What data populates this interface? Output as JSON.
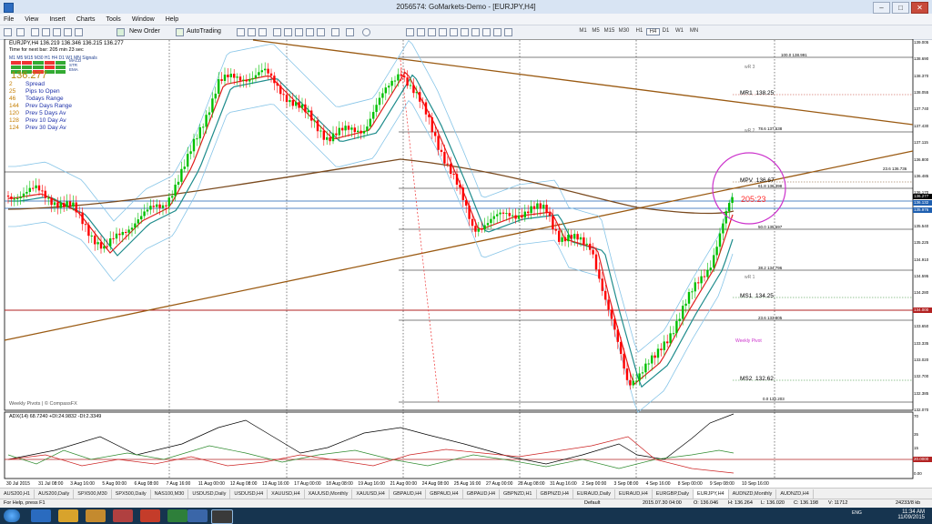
{
  "window": {
    "title": "2056574: GoMarkets-Demo - [EURJPY,H4]",
    "controls": [
      "–",
      "□",
      "✕"
    ]
  },
  "menu": [
    "File",
    "View",
    "Insert",
    "Charts",
    "Tools",
    "Window",
    "Help"
  ],
  "toolbar": {
    "new_order": "New Order",
    "autotrading": "AutoTrading",
    "timeframes": [
      "M1",
      "M5",
      "M15",
      "M30",
      "H1",
      "H4",
      "D1",
      "W1",
      "MN"
    ],
    "active_timeframe": "H4"
  },
  "chart": {
    "header": "EURJPY,H4  136.219 136.346 136.215 136.277",
    "time_next_bar": "Time for next bar: 205 min 23 sec",
    "signal_header": "M1 M5 M15 M30 H1 H4 D1 W1 MN   Signals",
    "indicator_names": [
      "MACD",
      "STR",
      "EMA"
    ],
    "price": "136.277",
    "stats": [
      {
        "value": "2",
        "label": "Spread"
      },
      {
        "value": "25",
        "label": "Pips to Open"
      },
      {
        "value": "46",
        "label": "Todays Range"
      },
      {
        "value": "144",
        "label": "Prev Days Range"
      },
      {
        "value": "120",
        "label": "Prev 5 Days Av"
      },
      {
        "value": "128",
        "label": "Prev 10 Day Av"
      },
      {
        "value": "124",
        "label": "Prev 30 Day Av"
      }
    ],
    "y_axis": [
      "139.005",
      "138.690",
      "138.370",
      "138.055",
      "137.740",
      "137.430",
      "137.115",
      "136.800",
      "136.485",
      "136.170",
      "135.855",
      "135.540",
      "135.225",
      "134.910",
      "134.595",
      "134.280",
      "133.965",
      "133.650",
      "133.335",
      "133.020",
      "132.700",
      "132.385",
      "132.070"
    ],
    "price_tags": [
      {
        "text": "136.277",
        "color": "#000000"
      },
      {
        "text": "136.132",
        "color": "#1e5fb0"
      },
      {
        "text": "135.976",
        "color": "#1e5fb0"
      },
      {
        "text": "134.000",
        "color": "#b22222"
      }
    ],
    "x_axis": [
      "30 Jul 2015",
      "31 Jul 08:00",
      "3 Aug 16:00",
      "5 Aug 00:00",
      "6 Aug 08:00",
      "7 Aug 16:00",
      "11 Aug 00:00",
      "12 Aug 08:00",
      "13 Aug 16:00",
      "17 Aug 00:00",
      "18 Aug 08:00",
      "19 Aug 16:00",
      "21 Aug 00:00",
      "24 Aug 08:00",
      "25 Aug 16:00",
      "27 Aug 00:00",
      "28 Aug 08:00",
      "31 Aug 16:00",
      "2 Sep 00:00",
      "3 Sep 08:00",
      "4 Sep 16:00",
      "8 Sep 00:00",
      "9 Sep 08:00",
      "10 Sep 16:00"
    ],
    "fib_levels": [
      "100.0  138.991",
      "78.6  137.538",
      "61.8  136.398",
      "50.0  135.597",
      "38.2  134.796",
      "23.6  133.805",
      "0.0  132.203",
      "23.6  136.736"
    ],
    "pivots": [
      {
        "label": "MR1",
        "value": "138.25"
      },
      {
        "label": "MPV",
        "value": "136.67"
      },
      {
        "label": "MS1",
        "value": "134.25"
      },
      {
        "label": "MS2",
        "value": "132.62"
      }
    ],
    "weekly_labels": [
      "wR 3",
      "wR 2",
      "wR 1",
      "Weekly Pivot"
    ],
    "countdown": "205:23",
    "watermark": "Weekly Pivots | © CompassFX",
    "sub_header": "ADX(14) 68.7240 +DI:24.9832 -DI:2.3349",
    "sub_y_axis": [
      "70",
      "35",
      "15",
      "0.00"
    ],
    "sub_tag": "20.0000",
    "colors": {
      "bull_candle": "#00c000",
      "bear_candle": "#ff0000",
      "ema_fast": "#e11d1d",
      "ema_mid": "#1e8c8c",
      "ema_slow": "#7a4a1e",
      "bollinger": "#87c5e8",
      "trendline": "#9a5a12",
      "circle": "#cc33cc"
    }
  },
  "tabs": [
    "AUS200,H1",
    "AUS200,Daily",
    "SPX500,M30",
    "SPX500,Daily",
    "NAS100,M30",
    "USDUSD,Daily",
    "USDUSD,H4",
    "XAUUSD,H4",
    "XAUUSD,Monthly",
    "XAUUSD,H4",
    "GBPAUD,H4",
    "GBPAUD,H4",
    "GBPAUD,H4",
    "GBPNZD,H1",
    "GBPNZD,H4",
    "EURAUD,Daily",
    "EURAUD,H4",
    "EURGBP,Daily",
    "EURJPY,H4",
    "AUDNZD,Monthly",
    "AUDNZD,H4"
  ],
  "active_tab": "EURJPY,H4",
  "status": {
    "help": "For Help, press F1",
    "profile": "Default",
    "datetime": "2015.07.30 04:00",
    "open": "O: 136.046",
    "high": "H: 136.264",
    "low": "L: 136.020",
    "close": "C: 136.198",
    "volume": "V: 11712",
    "traffic": "24233/8 kb"
  },
  "taskbar": {
    "language": "ENG",
    "time": "11:34 AM",
    "date": "11/09/2015"
  }
}
